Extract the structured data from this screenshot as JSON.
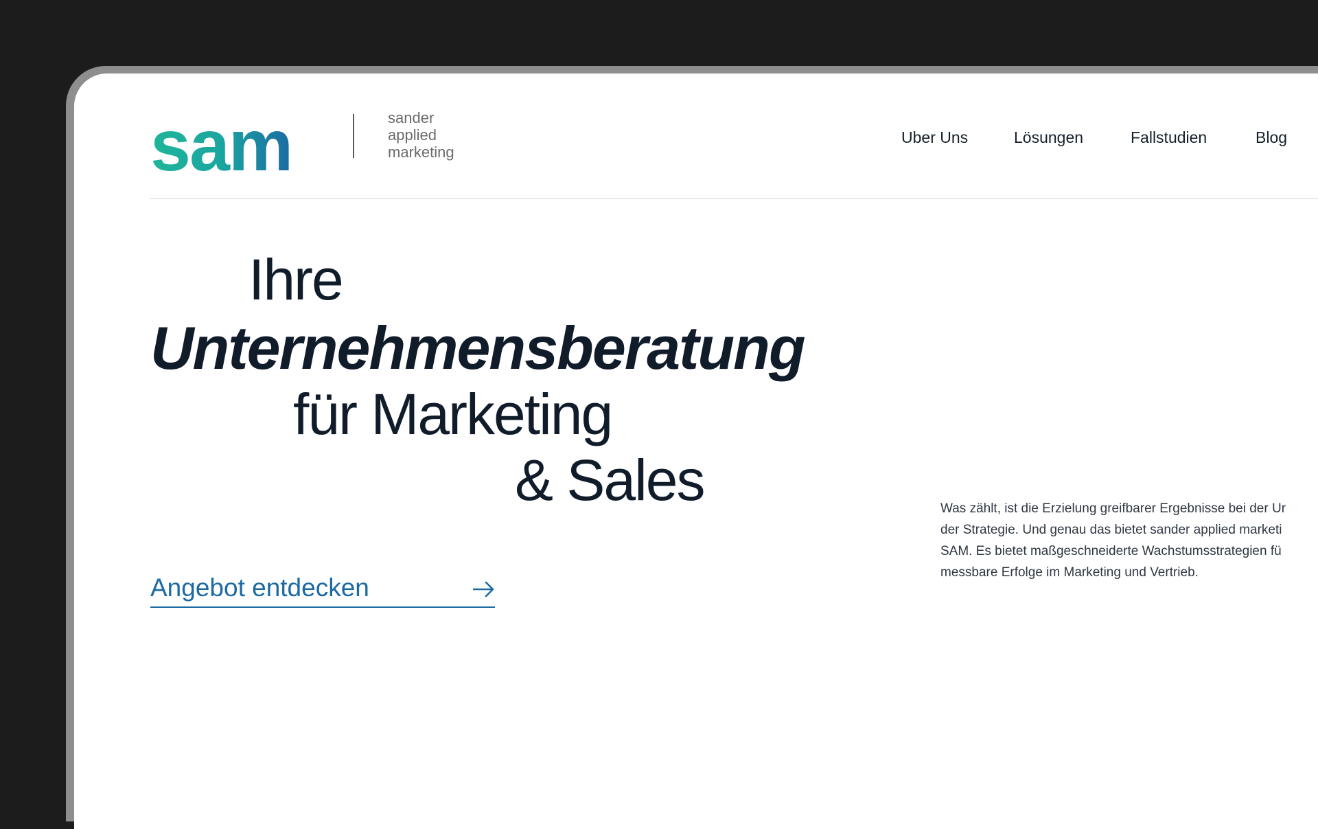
{
  "colors": {
    "logo_gradient_start": "#1fb59a",
    "logo_gradient_end": "#1b6aa3",
    "heading": "#111c2b",
    "accent": "#1b6aa3"
  },
  "logo": {
    "wordmark": "sam",
    "tagline": [
      "sander",
      "applied",
      "marketing"
    ]
  },
  "nav": {
    "items": [
      "Uber Uns",
      "Lösungen",
      "Fallstudien",
      "Blog"
    ]
  },
  "hero": {
    "line1": "Ihre",
    "line2": "Unternehmensberatung",
    "line3": "für Marketing",
    "line4": "& Sales"
  },
  "cta": {
    "label": "Angebot entdecken",
    "icon": "arrow-right-icon"
  },
  "intro": {
    "lines": [
      "Was zählt, ist die Erzielung greifbarer Ergebnisse bei der Ur",
      "der Strategie. Und genau das bietet sander applied marketi",
      "SAM. Es bietet maßgeschneiderte Wachstumsstrategien fü",
      "messbare Erfolge im Marketing und Vertrieb."
    ]
  }
}
